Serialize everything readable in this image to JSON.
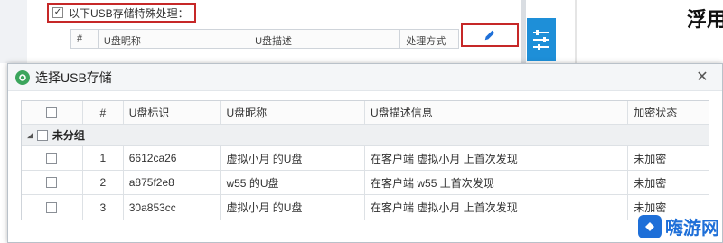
{
  "background_window": {
    "rule_checkbox_label": "以下USB存储特殊处理：",
    "rule_checkbox_checked": true,
    "table_columns": [
      "#",
      "U盘昵称",
      "U盘描述",
      "处理方式"
    ],
    "edit_icon": "pencil-icon",
    "right_text": "浮用"
  },
  "dialog": {
    "title": "选择USB存储",
    "close_glyph": "✕",
    "columns": {
      "check": "",
      "index": "#",
      "id": "U盘标识",
      "nickname": "U盘昵称",
      "description": "U盘描述信息",
      "encryption": "加密状态"
    },
    "group": {
      "label": "未分组",
      "collapse_glyph": "◢"
    },
    "rows": [
      {
        "index": "1",
        "id": "6612ca26",
        "nickname": "虚拟小月 的U盘",
        "description": "在客户端 虚拟小月 上首次发现",
        "encryption": "未加密"
      },
      {
        "index": "2",
        "id": "a875f2e8",
        "nickname": "w55 的U盘",
        "description": "在客户端 w55 上首次发现",
        "encryption": "未加密"
      },
      {
        "index": "3",
        "id": "30a853cc",
        "nickname": "虚拟小月 的U盘",
        "description": "在客户端 虚拟小月 上首次发现",
        "encryption": "未加密"
      }
    ]
  },
  "watermark": {
    "text": "嗨游网"
  },
  "colors": {
    "accent": "#1e8fd8",
    "highlight_border": "#c62828",
    "logo_green": "#3ba55c",
    "watermark_blue": "#1e6fd8"
  }
}
